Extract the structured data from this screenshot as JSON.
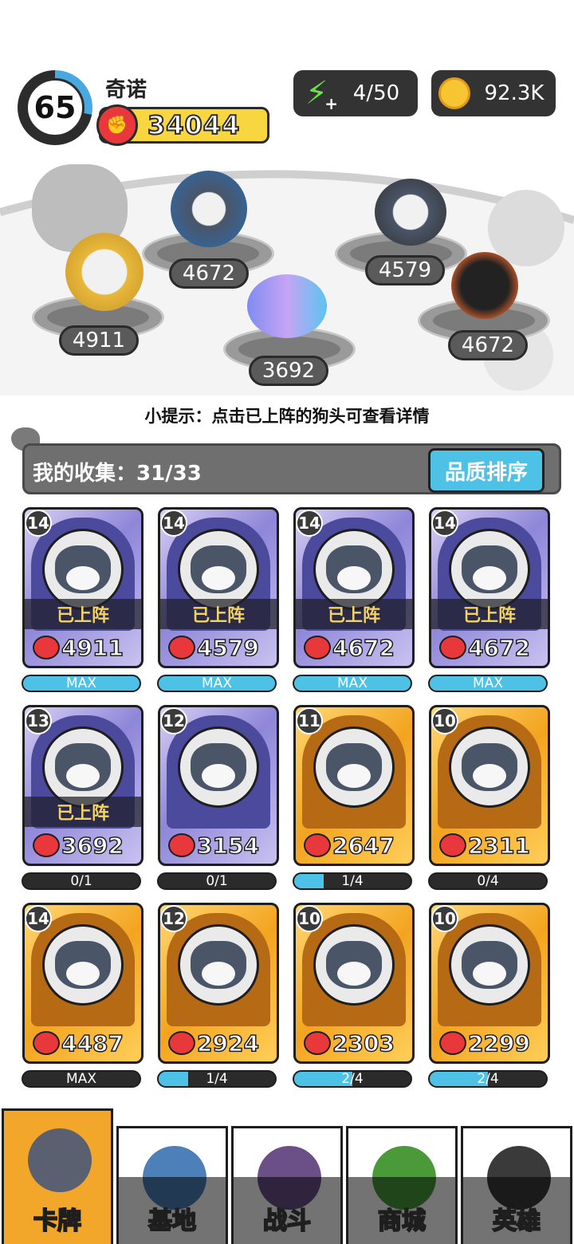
{
  "player": {
    "level": "65",
    "name": "奇诺",
    "power": "34044"
  },
  "resources": {
    "energy": "4/50",
    "coins": "92.3K"
  },
  "arena": {
    "scores": [
      "4911",
      "4672",
      "3692",
      "4579",
      "4672"
    ]
  },
  "tip": "小提示：点击已上阵的狗头可查看详情",
  "collection": {
    "label": "我的收集：31/33",
    "sort_button": "品质排序"
  },
  "cards": [
    {
      "level": "14",
      "power": "4911",
      "rarity": "purple",
      "deployed": "已上阵",
      "progress": "MAX",
      "fill": 1.0
    },
    {
      "level": "14",
      "power": "4579",
      "rarity": "purple",
      "deployed": "已上阵",
      "progress": "MAX",
      "fill": 1.0
    },
    {
      "level": "14",
      "power": "4672",
      "rarity": "purple",
      "deployed": "已上阵",
      "progress": "MAX",
      "fill": 1.0
    },
    {
      "level": "14",
      "power": "4672",
      "rarity": "purple",
      "deployed": "已上阵",
      "progress": "MAX",
      "fill": 1.0
    },
    {
      "level": "13",
      "power": "3692",
      "rarity": "purple",
      "deployed": "已上阵",
      "progress": "0/1",
      "fill": 0.0
    },
    {
      "level": "12",
      "power": "3154",
      "rarity": "purple",
      "deployed": "",
      "progress": "0/1",
      "fill": 0.0
    },
    {
      "level": "11",
      "power": "2647",
      "rarity": "gold",
      "deployed": "",
      "progress": "1/4",
      "fill": 0.25
    },
    {
      "level": "10",
      "power": "2311",
      "rarity": "gold",
      "deployed": "",
      "progress": "0/4",
      "fill": 0.0
    },
    {
      "level": "14",
      "power": "4487",
      "rarity": "gold",
      "deployed": "",
      "progress": "MAX",
      "fill": 0.0
    },
    {
      "level": "12",
      "power": "2924",
      "rarity": "gold",
      "deployed": "",
      "progress": "1/4",
      "fill": 0.25
    },
    {
      "level": "10",
      "power": "2303",
      "rarity": "gold",
      "deployed": "",
      "progress": "2/4",
      "fill": 0.5
    },
    {
      "level": "10",
      "power": "2299",
      "rarity": "gold",
      "deployed": "",
      "progress": "2/4",
      "fill": 0.5
    }
  ],
  "nav": [
    {
      "label": "卡牌",
      "icon": "dog-card-icon"
    },
    {
      "label": "基地",
      "icon": "castle-icon"
    },
    {
      "label": "战斗",
      "icon": "paw-icon"
    },
    {
      "label": "商城",
      "icon": "cash-icon"
    },
    {
      "label": "英雄",
      "icon": "hero-dog-icon"
    }
  ],
  "colors": {
    "accent_blue": "#4ec2e6",
    "gold": "#f2a72a",
    "power_red": "#e8383b"
  }
}
